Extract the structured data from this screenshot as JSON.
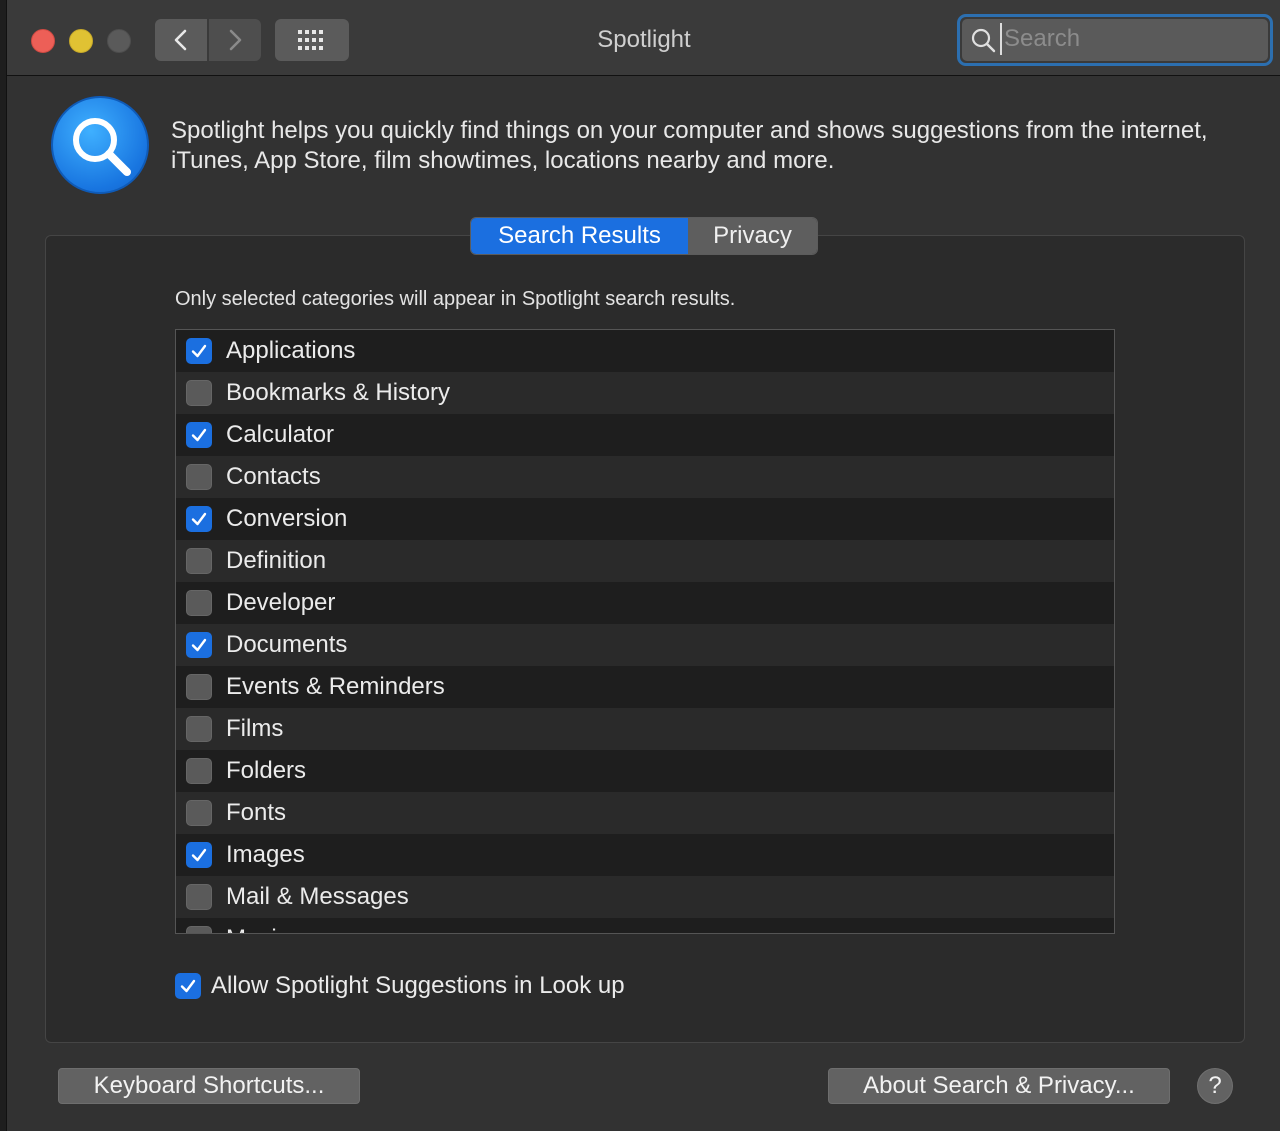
{
  "window": {
    "title": "Spotlight",
    "search_placeholder": "Search"
  },
  "header": {
    "description": "Spotlight helps you quickly find things on your computer and shows suggestions from the internet, iTunes, App Store, film showtimes, locations nearby and more."
  },
  "tabs": [
    {
      "label": "Search Results",
      "active": true
    },
    {
      "label": "Privacy",
      "active": false
    }
  ],
  "main": {
    "hint": "Only selected categories will appear in Spotlight search results.",
    "categories": [
      {
        "label": "Applications",
        "checked": true
      },
      {
        "label": "Bookmarks & History",
        "checked": false
      },
      {
        "label": "Calculator",
        "checked": true
      },
      {
        "label": "Contacts",
        "checked": false
      },
      {
        "label": "Conversion",
        "checked": true
      },
      {
        "label": "Definition",
        "checked": false
      },
      {
        "label": "Developer",
        "checked": false
      },
      {
        "label": "Documents",
        "checked": true
      },
      {
        "label": "Events & Reminders",
        "checked": false
      },
      {
        "label": "Films",
        "checked": false
      },
      {
        "label": "Folders",
        "checked": false
      },
      {
        "label": "Fonts",
        "checked": false
      },
      {
        "label": "Images",
        "checked": true
      },
      {
        "label": "Mail & Messages",
        "checked": false
      },
      {
        "label": "Music",
        "checked": false
      }
    ],
    "allow_suggestions": {
      "label": "Allow Spotlight Suggestions in Look up",
      "checked": true
    }
  },
  "footer": {
    "keyboard_shortcuts": "Keyboard Shortcuts...",
    "about": "About Search & Privacy...",
    "help": "?"
  },
  "colors": {
    "accent": "#1b6fe0",
    "close": "#ed5f57",
    "minimize": "#e0c233"
  }
}
